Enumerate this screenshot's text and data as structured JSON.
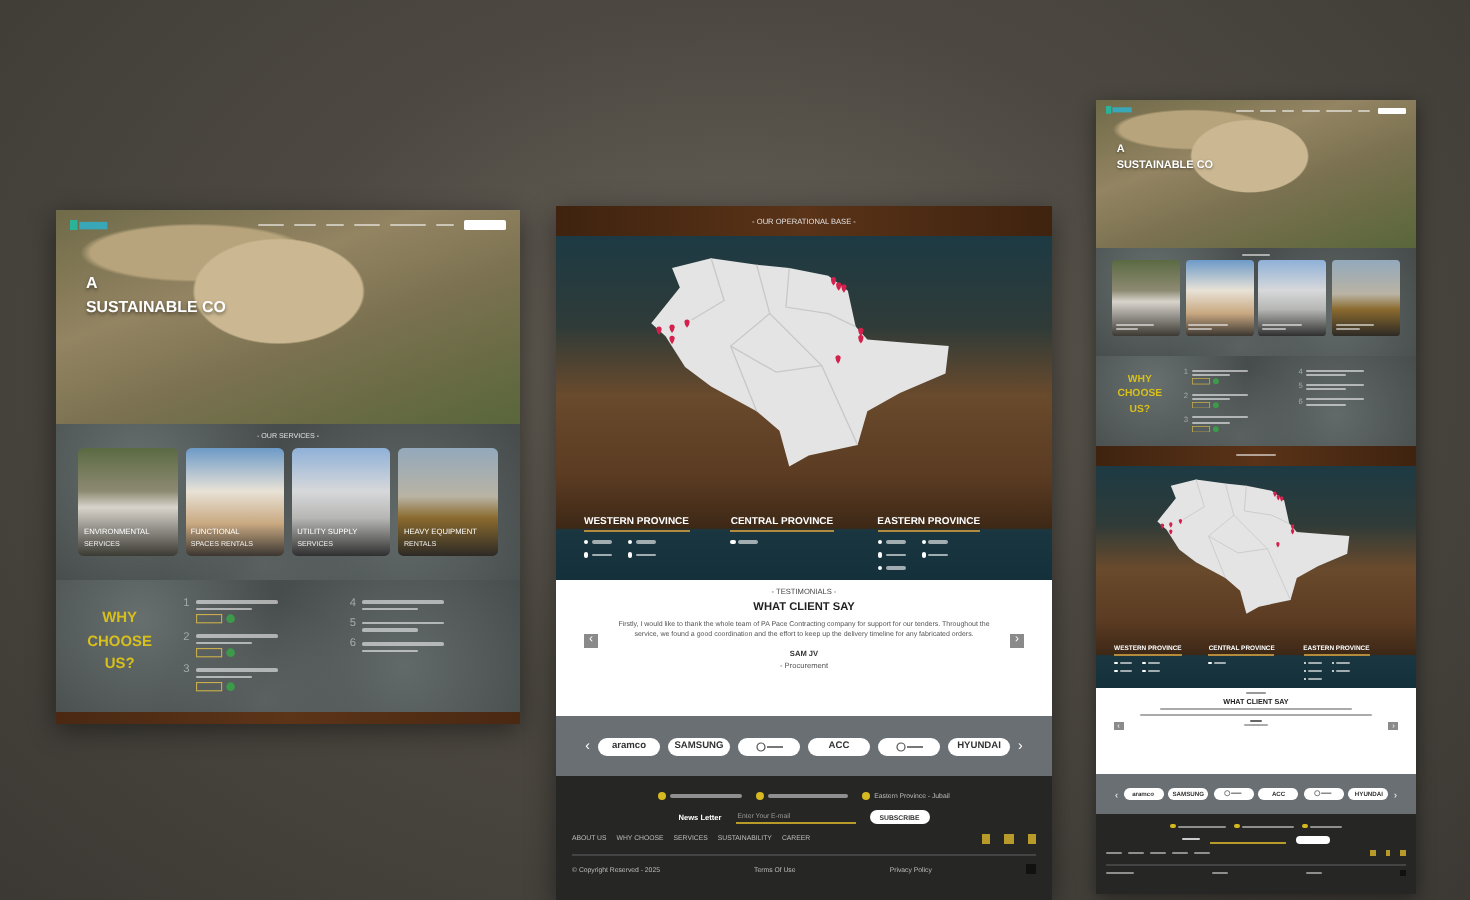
{
  "screens": [
    {
      "sections": [
        {
          "kind": "hero",
          "title_lines": [
            "A",
            "SUSTAINABLE CO"
          ]
        },
        {
          "kind": "services",
          "heading": "- OUR SERVICES -",
          "cards": [
            {
              "title": "ENVIRONMENTAL",
              "subtitle": "SERVICES"
            },
            {
              "title": "FUNCTIONAL",
              "subtitle": "SPACES RENTALS"
            },
            {
              "title": "UTILITY SUPPLY",
              "subtitle": "SERVICES"
            },
            {
              "title": "HEAVY EQUIPMENT",
              "subtitle": "RENTALS"
            }
          ]
        },
        {
          "kind": "why",
          "title_lines": [
            "WHY",
            "CHOOSE",
            "US?"
          ],
          "items": [
            {
              "number": "1",
              "badge": true
            },
            {
              "number": "2",
              "badge": true
            },
            {
              "number": "3",
              "badge": true
            },
            {
              "number": "4",
              "badge": false
            },
            {
              "number": "5",
              "badge": false
            },
            {
              "number": "6",
              "badge": false
            }
          ]
        },
        {
          "kind": "band"
        }
      ]
    },
    {
      "sections": [
        {
          "kind": "map",
          "heading": "- OUR OPERATIONAL BASE -",
          "provinces": [
            {
              "name": "WESTERN PROVINCE"
            },
            {
              "name": "CENTRAL PROVINCE"
            },
            {
              "name": "EASTERN PROVINCE"
            }
          ]
        },
        {
          "kind": "testimonials",
          "heading": "- TESTIMONIALS -",
          "title": "WHAT CLIENT SAY",
          "quote": "Firstly, I would like to thank the whole team of PA Pace Contracting company for support for our tenders. Throughout the service, we found a good coordination and the effort to keep up the delivery timeline for any fabricated orders.",
          "name": "SAM JV",
          "role": "- Procurement",
          "prev": "‹",
          "next": "›"
        },
        {
          "kind": "clients",
          "prev": "‹",
          "next": "›",
          "logos": [
            {
              "kind": "text",
              "text": "aramco"
            },
            {
              "kind": "text",
              "text": "SAMSUNG"
            },
            {
              "kind": "mark"
            },
            {
              "kind": "text",
              "text": "ACC"
            },
            {
              "kind": "mark"
            },
            {
              "kind": "text",
              "text": "HYUNDAI"
            }
          ]
        },
        {
          "kind": "footer",
          "location": "Eastern Province - Jubail",
          "newsletter_label": "News Letter",
          "email_placeholder": "Enter Your E-mail",
          "subscribe": "SUBSCRIBE",
          "links": [
            "ABOUT US",
            "WHY CHOOSE",
            "SERVICES",
            "SUSTAINABILITY",
            "CAREER"
          ],
          "copyright": "© Copyright Reserved - 2025",
          "terms": "Terms Of Use",
          "privacy": "Privacy Policy"
        }
      ]
    },
    {
      "sections": [
        {
          "kind": "hero",
          "title_lines": [
            "A",
            "SUSTAINABLE CO"
          ]
        },
        {
          "kind": "services"
        },
        {
          "kind": "why",
          "title_lines": [
            "WHY",
            "CHOOSE",
            "US?"
          ],
          "items": [
            {
              "number": "1",
              "badge": true
            },
            {
              "number": "2",
              "badge": true
            },
            {
              "number": "3",
              "badge": true
            },
            {
              "number": "4",
              "badge": false
            },
            {
              "number": "5",
              "badge": false
            },
            {
              "number": "6",
              "badge": false
            }
          ]
        },
        {
          "kind": "map",
          "provinces": [
            {
              "name": "WESTERN PROVINCE"
            },
            {
              "name": "CENTRAL PROVINCE"
            },
            {
              "name": "EASTERN PROVINCE"
            }
          ]
        },
        {
          "kind": "testimonials",
          "title": "WHAT CLIENT SAY",
          "prev": "‹",
          "next": "›"
        },
        {
          "kind": "clients",
          "prev": "‹",
          "next": "›",
          "logos": [
            {
              "kind": "text",
              "text": "aramco"
            },
            {
              "kind": "text",
              "text": "SAMSUNG"
            },
            {
              "kind": "mark"
            },
            {
              "kind": "text",
              "text": "ACC"
            },
            {
              "kind": "mark"
            },
            {
              "kind": "text",
              "text": "HYUNDAI"
            }
          ]
        },
        {
          "kind": "footer"
        }
      ]
    }
  ]
}
